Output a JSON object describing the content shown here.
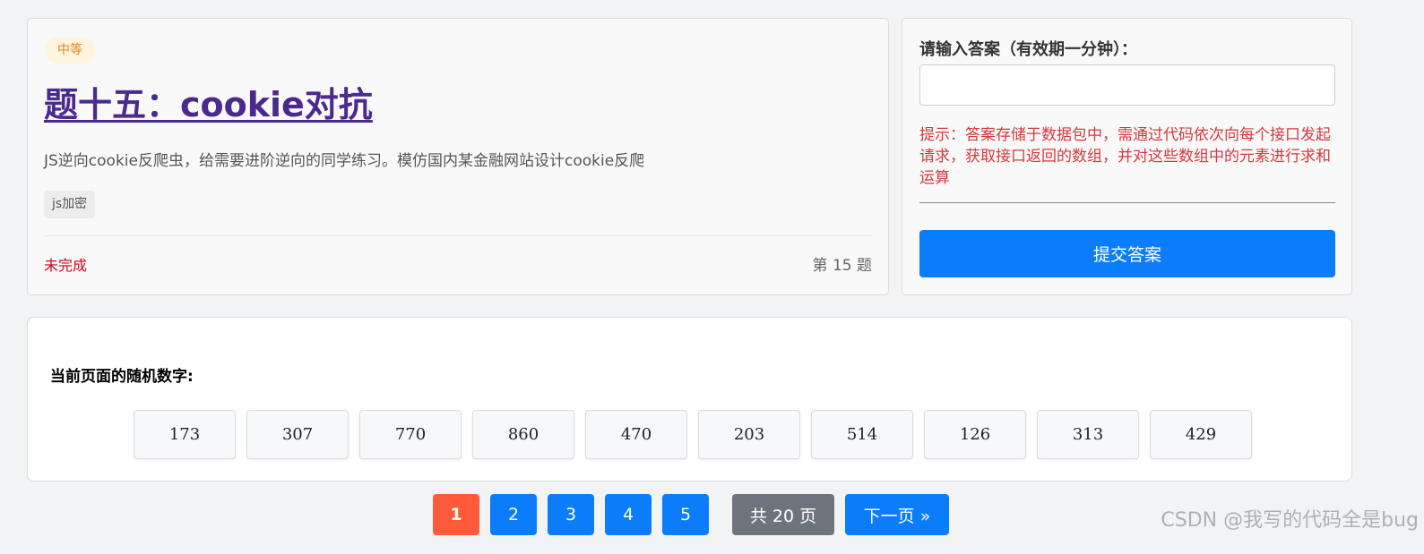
{
  "challenge": {
    "difficulty": "中等",
    "title": "题十五：cookie对抗",
    "description": "JS逆向cookie反爬虫，给需要进阶逆向的同学练习。模仿国内某金融网站设计cookie反爬",
    "tag": "js加密",
    "status": "未完成",
    "number_label": "第 15 题"
  },
  "answer_panel": {
    "label": "请输入答案（有效期一分钟）：",
    "input_value": "",
    "input_placeholder": "",
    "hint": "提示：答案存储于数据包中，需通过代码依次向每个接口发起请求，获取接口返回的数组，并对这些数组中的元素进行求和运算",
    "submit_label": "提交答案"
  },
  "numbers_panel": {
    "label": "当前页面的随机数字:",
    "values": [
      "173",
      "307",
      "770",
      "860",
      "470",
      "203",
      "514",
      "126",
      "313",
      "429"
    ]
  },
  "pagination": {
    "pages": [
      "1",
      "2",
      "3",
      "4",
      "5"
    ],
    "current": "1",
    "total_label": "共 20 页",
    "next_label": "下一页 »"
  },
  "watermark": "CSDN @我写的代码全是bug",
  "colors": {
    "primary": "#0b7dfb",
    "active_page": "#ff5b3b",
    "title": "#4a2a8e",
    "error": "#d9363e",
    "status_incomplete": "#d9001b",
    "difficulty_bg": "#fff4dd",
    "difficulty_text": "#e6851e",
    "total_badge": "#6c757d"
  }
}
